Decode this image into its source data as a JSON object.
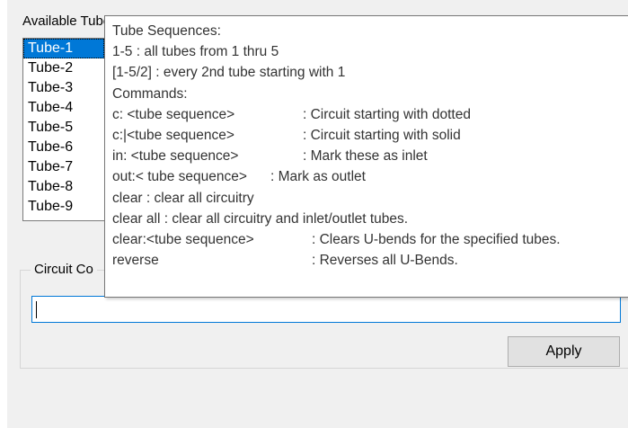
{
  "dialog": {
    "available_label": "Available Tubes",
    "tubes": [
      {
        "label": "Tube-1",
        "selected": true
      },
      {
        "label": "Tube-2",
        "selected": false
      },
      {
        "label": "Tube-3",
        "selected": false
      },
      {
        "label": "Tube-4",
        "selected": false
      },
      {
        "label": "Tube-5",
        "selected": false
      },
      {
        "label": "Tube-6",
        "selected": false
      },
      {
        "label": "Tube-7",
        "selected": false
      },
      {
        "label": "Tube-8",
        "selected": false
      },
      {
        "label": "Tube-9",
        "selected": false
      }
    ],
    "circuit_group_label": "Circuit Co",
    "circuit_input_value": "",
    "apply_label": "Apply",
    "selection_color": "#0078d7"
  },
  "tooltip": {
    "lines": [
      {
        "cmd": "Tube Sequences:",
        "desc": ""
      },
      {
        "cmd": "1-5 : all tubes from 1 thru 5",
        "desc": ""
      },
      {
        "cmd": "[1-5/2] : every 2nd tube starting with 1",
        "desc": ""
      },
      {
        "cmd": "Commands:",
        "desc": ""
      },
      {
        "cmd": "c: <tube sequence>",
        "desc": ": Circuit starting with dotted"
      },
      {
        "cmd": "c:|<tube sequence>",
        "desc": ": Circuit starting with solid"
      },
      {
        "cmd": "in: <tube sequence>",
        "desc": ": Mark these as inlet"
      },
      {
        "cmd": "out:< tube sequence>",
        "desc": ": Mark as outlet"
      },
      {
        "cmd": "clear : clear all circuitry",
        "desc": ""
      },
      {
        "cmd": "clear all : clear all circuitry and inlet/outlet tubes.",
        "desc": ""
      },
      {
        "cmd": "clear:<tube sequence>",
        "desc": ": Clears U-bends for the specified tubes."
      },
      {
        "cmd": "reverse",
        "desc": ": Reverses all U-Bends."
      }
    ]
  }
}
